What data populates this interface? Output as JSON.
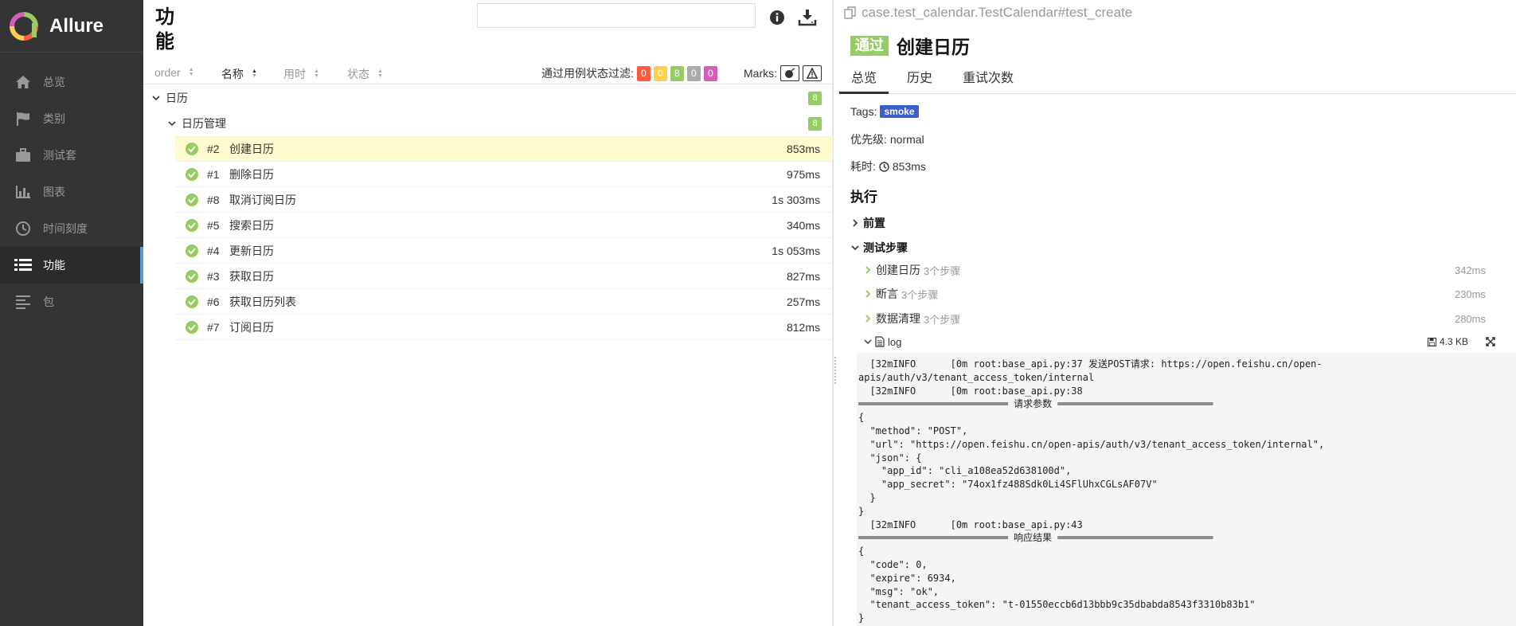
{
  "sidebar": {
    "brand": "Allure",
    "items": [
      {
        "label": "总览",
        "icon": "home-icon",
        "active": false
      },
      {
        "label": "类别",
        "icon": "flag-icon",
        "active": false
      },
      {
        "label": "测试套",
        "icon": "briefcase-icon",
        "active": false
      },
      {
        "label": "图表",
        "icon": "bar-chart-icon",
        "active": false
      },
      {
        "label": "时间刻度",
        "icon": "clock-icon",
        "active": false
      },
      {
        "label": "功能",
        "icon": "list-icon",
        "active": true
      },
      {
        "label": "包",
        "icon": "align-left-icon",
        "active": false
      }
    ]
  },
  "main": {
    "title": "功能",
    "search_value": "",
    "sort": {
      "order": "order",
      "name": "名称",
      "duration": "用时",
      "status": "状态"
    },
    "filter": {
      "label": "通过用例状态过滤:",
      "chips": [
        {
          "count": "0",
          "color": "#fd5a3e"
        },
        {
          "count": "0",
          "color": "#ffd050"
        },
        {
          "count": "8",
          "color": "#97cc64"
        },
        {
          "count": "0",
          "color": "#aaaaaa"
        },
        {
          "count": "0",
          "color": "#d35ebe"
        }
      ]
    },
    "marks_label": "Marks:",
    "tree": {
      "group1": {
        "label": "日历",
        "count": "8"
      },
      "group2": {
        "label": "日历管理",
        "count": "8"
      },
      "rows": [
        {
          "num": "#2",
          "name": "创建日历",
          "dur": "853ms"
        },
        {
          "num": "#1",
          "name": "删除日历",
          "dur": "975ms"
        },
        {
          "num": "#8",
          "name": "取消订阅日历",
          "dur": "1s 303ms"
        },
        {
          "num": "#5",
          "name": "搜索日历",
          "dur": "340ms"
        },
        {
          "num": "#4",
          "name": "更新日历",
          "dur": "1s 053ms"
        },
        {
          "num": "#3",
          "name": "获取日历",
          "dur": "827ms"
        },
        {
          "num": "#6",
          "name": "获取日历列表",
          "dur": "257ms"
        },
        {
          "num": "#7",
          "name": "订阅日历",
          "dur": "812ms"
        }
      ]
    }
  },
  "detail": {
    "full_name": "case.test_calendar.TestCalendar#test_create",
    "status": "通过",
    "status_color": "#97cc64",
    "name": "创建日历",
    "tabs": [
      "总览",
      "历史",
      "重试次数"
    ],
    "tags_label": "Tags:",
    "tag": "smoke",
    "priority_label": "优先级:",
    "priority": "normal",
    "duration_label": "耗时:",
    "duration": "853ms",
    "exec_title": "执行",
    "setup": "前置",
    "steps_title": "测试步骤",
    "steps": [
      {
        "name": "创建日历",
        "sub": "3个步骤",
        "dur": "342ms"
      },
      {
        "name": "断言",
        "sub": "3个步骤",
        "dur": "230ms"
      },
      {
        "name": "数据清理",
        "sub": "3个步骤",
        "dur": "280ms"
      }
    ],
    "log": {
      "name": "log",
      "size": "4.3 KB"
    },
    "log_text": "  [32mINFO      [0m root:base_api.py:37 发送POST请求: https://open.feishu.cn/open-\napis/auth/v3/tenant_access_token/internal\n  [32mINFO      [0m root:base_api.py:38\n══════════════════════════ 请求参数 ═══════════════════════════\n{\n  \"method\": \"POST\",\n  \"url\": \"https://open.feishu.cn/open-apis/auth/v3/tenant_access_token/internal\",\n  \"json\": {\n    \"app_id\": \"cli_a108ea52d638100d\",\n    \"app_secret\": \"74ox1fz488Sdk0Li4SFlUhxCGLsAF07V\"\n  }\n}\n  [32mINFO      [0m root:base_api.py:43\n══════════════════════════ 响应结果 ═══════════════════════════\n{\n  \"code\": 0,\n  \"expire\": 6934,\n  \"msg\": \"ok\",\n  \"tenant_access_token\": \"t-01550eccb6d13bbb9c35dbabda8543f3310b83b1\"\n}"
  }
}
